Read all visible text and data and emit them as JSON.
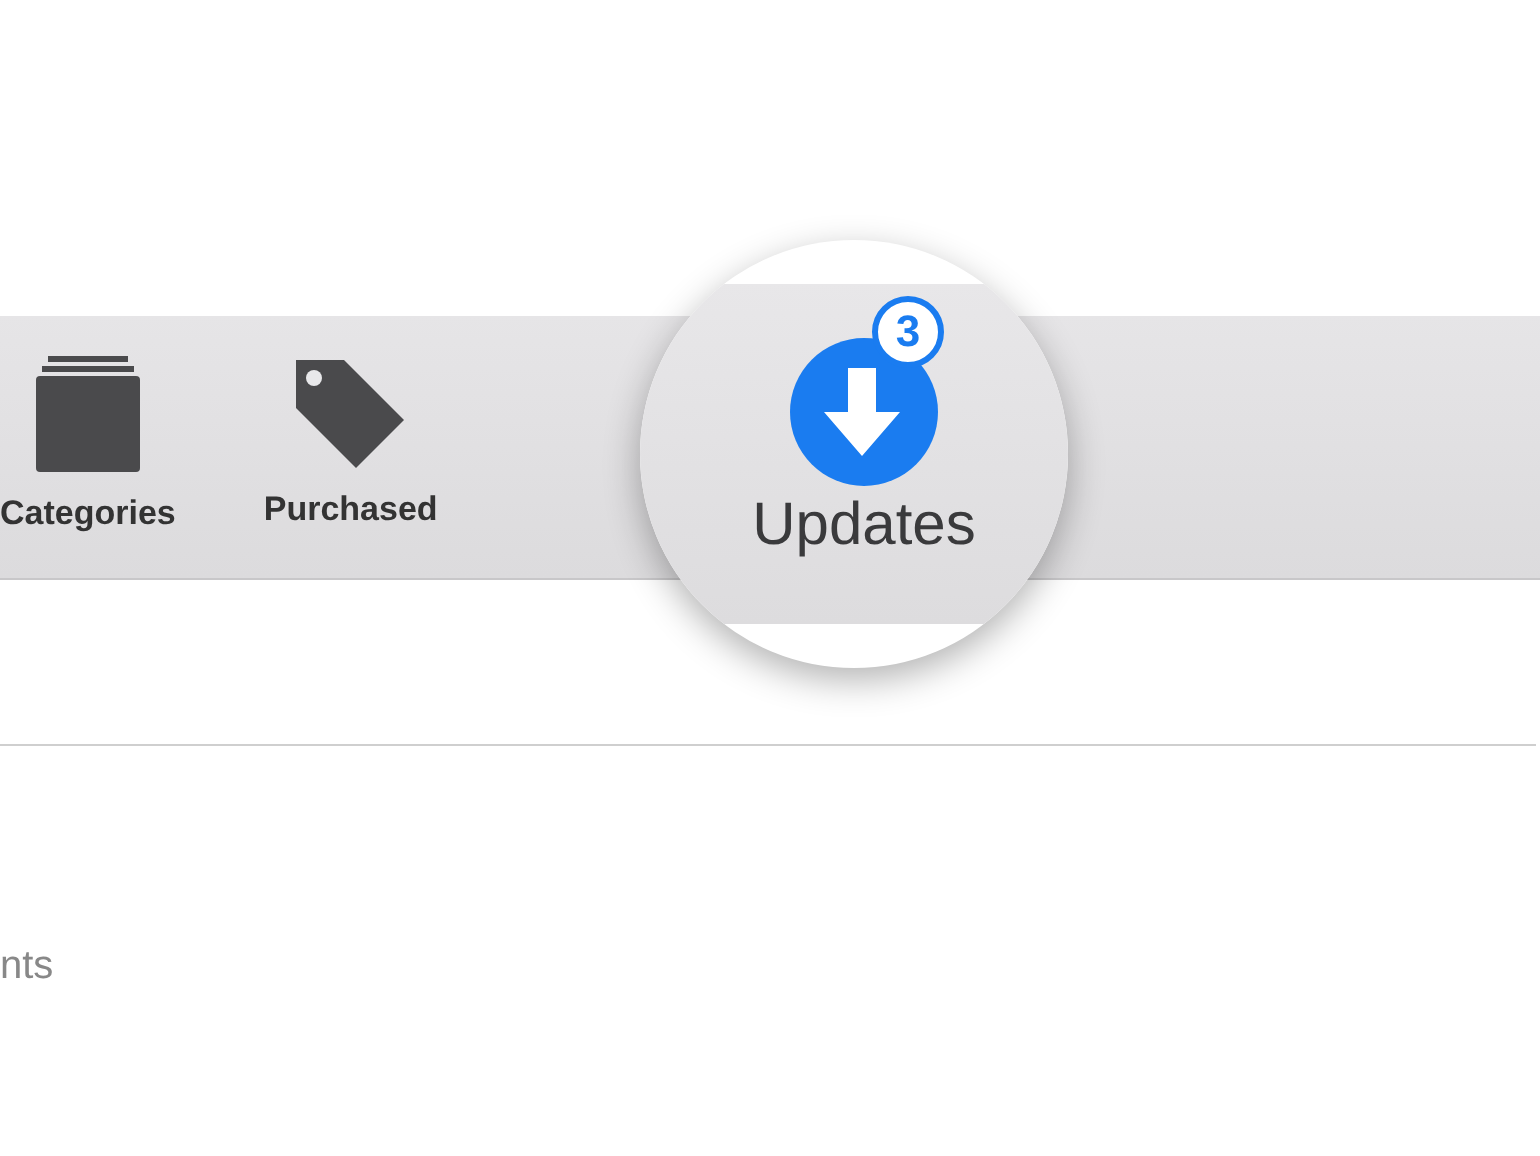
{
  "toolbar": {
    "items": [
      {
        "label": "Categories",
        "kind": "categories"
      },
      {
        "label": "Purchased",
        "kind": "purchased"
      }
    ]
  },
  "magnifier": {
    "label": "Updates",
    "badge": "3"
  },
  "content": {
    "text": "nts"
  }
}
